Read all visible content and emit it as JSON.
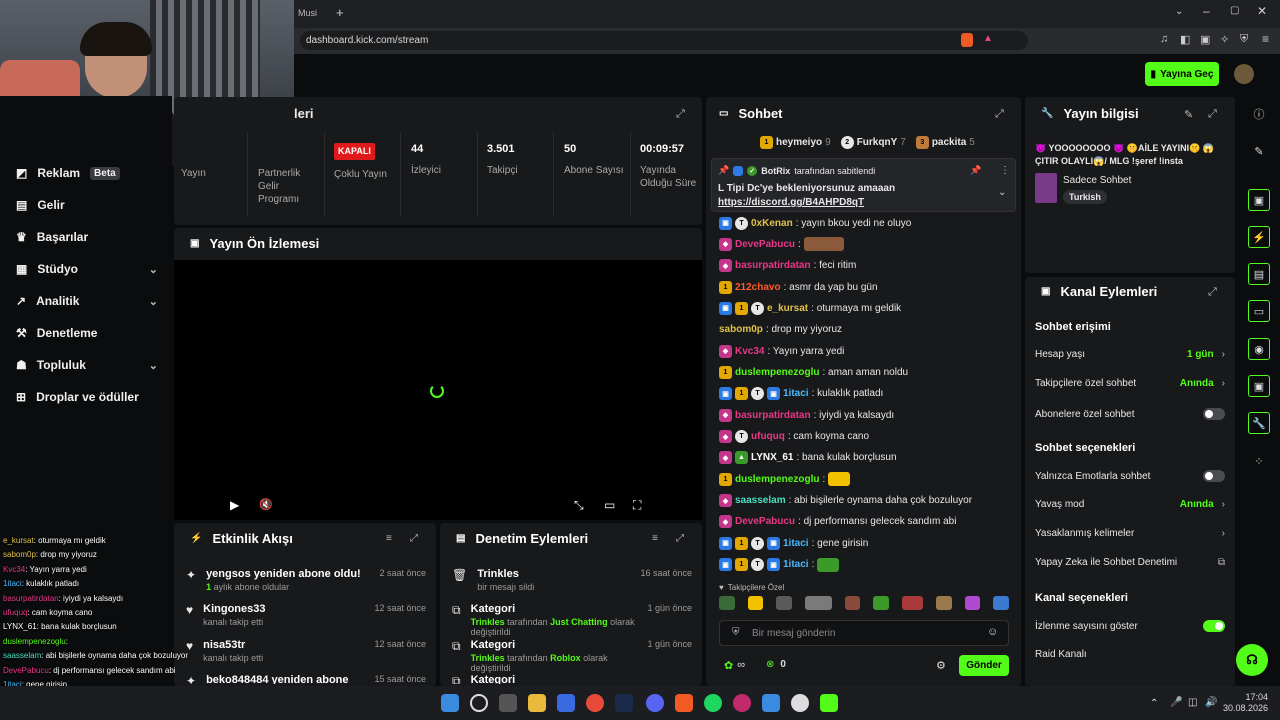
{
  "browser": {
    "tab_label": "Musi",
    "new_tab": "+",
    "url": "dashboard.kick.com/stream"
  },
  "header": {
    "go_live": "Yayına Geç"
  },
  "sidebar": {
    "items": [
      {
        "label": "Reklam",
        "badge": "Beta",
        "icon": "megaphone-icon"
      },
      {
        "label": "Gelir",
        "icon": "wallet-icon"
      },
      {
        "label": "Başarılar",
        "icon": "trophy-icon"
      },
      {
        "label": "Stüdyo",
        "icon": "grid-icon",
        "chevron": true
      },
      {
        "label": "Analitik",
        "icon": "chart-icon",
        "chevron": true
      },
      {
        "label": "Denetleme",
        "icon": "hammer-icon"
      },
      {
        "label": "Topluluk",
        "icon": "people-icon",
        "chevron": true
      },
      {
        "label": "Droplar ve ödüller",
        "icon": "gift-icon"
      }
    ]
  },
  "stream_panel": {
    "title_fragment": "leri",
    "stats": [
      {
        "value": "",
        "label": "Yayın"
      },
      {
        "value": "",
        "label": "Partnerlik Gelir Programı"
      },
      {
        "value": "KAPALI",
        "label": "Çoklu Yayın"
      },
      {
        "value": "44",
        "label": "İzleyici"
      },
      {
        "value": "3.501",
        "label": "Takipçi"
      },
      {
        "value": "50",
        "label": "Abone Sayısı"
      },
      {
        "value": "00:09:57",
        "label": "Yayında Olduğu Süre"
      }
    ]
  },
  "preview": {
    "title": "Yayın Ön İzlemesi"
  },
  "activity": {
    "title": "Etkinlik Akışı",
    "items": [
      {
        "name": "yengsos yeniden abone oldu!",
        "detail_count": "1",
        "detail": " aylık abone oldular",
        "time": "2 saat önce",
        "icon": "star-icon"
      },
      {
        "name": "Kingones33",
        "detail": "kanalı takip etti",
        "time": "12 saat önce",
        "icon": "heart-icon"
      },
      {
        "name": "nisa53tr",
        "detail": "kanalı takip etti",
        "time": "12 saat önce",
        "icon": "heart-icon"
      },
      {
        "name": "beko848484 yeniden abone oldu!",
        "detail": "",
        "time": "15 saat önce",
        "icon": "star-icon"
      }
    ]
  },
  "moderation": {
    "title": "Denetim Eylemleri",
    "items": [
      {
        "name": "Trinkles",
        "detail": "bir mesajı sildi",
        "time": "16 saat önce",
        "icon": "trash-icon"
      },
      {
        "name": "Kategori",
        "actor": "Trinkles",
        "mid": " tarafından ",
        "target": "Just Chatting",
        "tail": " olarak değiştirildi",
        "time": "1 gün önce",
        "icon": "swap-icon"
      },
      {
        "name": "Kategori",
        "actor": "Trinkles",
        "mid": " tarafından ",
        "target": "Roblox",
        "tail": " olarak değiştirildi",
        "time": "1 gün önce",
        "icon": "swap-icon"
      },
      {
        "name": "Kategori",
        "time": "",
        "icon": "swap-icon"
      }
    ]
  },
  "chat": {
    "title": "Sohbet",
    "top_gifters": [
      {
        "name": "heymeiyo",
        "count": "9",
        "rank": "1"
      },
      {
        "name": "FurkqnY",
        "count": "7",
        "rank": "2"
      },
      {
        "name": "packita",
        "count": "5",
        "rank": "3"
      }
    ],
    "pinned": {
      "by": "BotRix",
      "by_suffix": " tarafından sabitlendi",
      "text": "L Tipi Dc'ye bekleniyorsunuz amaaan",
      "link": "https://discord.gg/B4AHPD8qT"
    },
    "messages": [
      {
        "user": "0xKenan",
        "color": "#e0c24a",
        "text": ": yayın bkou yedi ne oluyo",
        "badges": [
          "sub",
          "white"
        ]
      },
      {
        "user": "DevePabucu",
        "color": "#e8388a",
        "text": ":",
        "badges": [
          "pink"
        ],
        "emote": "#8a5a3a"
      },
      {
        "user": "basurpatirdatan",
        "color": "#e8388a",
        "text": ": feci ritim",
        "badges": [
          "pink"
        ]
      },
      {
        "user": "212chavo",
        "color": "#ff5a2a",
        "text": ": asmr da yap bu gün",
        "badges": [
          "gold"
        ]
      },
      {
        "user": "e_kursat",
        "color": "#e0c24a",
        "text": ": oturmaya mı geldik",
        "badges": [
          "sub",
          "gold",
          "white"
        ]
      },
      {
        "user": "sabom0p",
        "color": "#e0c24a",
        "text": ": drop my yiyoruz",
        "badges": []
      },
      {
        "user": "Kvc34",
        "color": "#e8388a",
        "text": ": Yayın yarra yedi",
        "badges": [
          "pink"
        ]
      },
      {
        "user": "duslempenezoglu",
        "color": "#53fc18",
        "text": ": aman aman noldu",
        "badges": [
          "gold"
        ]
      },
      {
        "user": "1itaci",
        "color": "#4ab8ff",
        "text": ": kulaklık patladı",
        "badges": [
          "sub",
          "gold",
          "white",
          "sub"
        ]
      },
      {
        "user": "basurpatirdatan",
        "color": "#e8388a",
        "text": ": iyiydi ya kalsaydı",
        "badges": [
          "pink"
        ]
      },
      {
        "user": "ufuquq",
        "color": "#e8388a",
        "text": ": cam koyma cano",
        "badges": [
          "pink",
          "white"
        ]
      },
      {
        "user": "LYNX_61",
        "color": "#ffffff",
        "text": ": bana kulak borçlusun",
        "badges": [
          "pink",
          "green"
        ]
      },
      {
        "user": "duslempenezoglu",
        "color": "#53fc18",
        "text": ":",
        "badges": [
          "gold"
        ],
        "emote": "#f2c200"
      },
      {
        "user": "saasselam",
        "color": "#4ae0c2",
        "text": ": abi bişilerle oynama daha çok bozuluyor",
        "badges": [
          "pink"
        ]
      },
      {
        "user": "DevePabucu",
        "color": "#e8388a",
        "text": ": dj performansı gelecek sandım abi",
        "badges": [
          "pink"
        ]
      },
      {
        "user": "1itaci",
        "color": "#4ab8ff",
        "text": ": gene girisin",
        "badges": [
          "sub",
          "gold",
          "white",
          "sub"
        ]
      },
      {
        "user": "1itaci",
        "color": "#4ab8ff",
        "text": ":",
        "badges": [
          "sub",
          "gold",
          "white",
          "sub"
        ],
        "emote": "#3a9a2a"
      }
    ],
    "followers_label": "Takipçilere Özel",
    "input_placeholder": "Bir mesaj gönderin",
    "infinity": "∞",
    "count": "0",
    "send": "Gönder"
  },
  "stream_info": {
    "title": "Yayın bilgisi",
    "stream_title": "👿 YOOOOOOOO 👿 🤫AİLE YAYINI🤫 😱ÇITIR OLAYLI😱/ MLG !şeref !insta",
    "category": "Sadece Sohbet",
    "tag": "Turkish"
  },
  "channel_actions": {
    "title": "Kanal Eylemleri",
    "chat_access": "Sohbet erişimi",
    "account_age": {
      "label": "Hesap yaşı",
      "value": "1 gün"
    },
    "followers_only": {
      "label": "Takipçilere özel sohbet",
      "value": "Anında"
    },
    "subs_only": {
      "label": "Abonelere özel sohbet",
      "on": false
    },
    "chat_options": "Sohbet seçenekleri",
    "emote_only": {
      "label": "Yalnızca Emotlarla sohbet",
      "on": false
    },
    "slow_mode": {
      "label": "Yavaş mod",
      "value": "Anında"
    },
    "banned_words": "Yasaklanmış kelimeler",
    "ai_moderation": "Yapay Zeka ile Sohbet Denetimi",
    "channel_options": "Kanal seçenekleri",
    "show_viewers": {
      "label": "İzlenme sayısını göster",
      "on": true
    },
    "raid": "Raid Kanalı"
  },
  "overlay_chat": [
    {
      "user": "e_kursat",
      "text": ": oturmaya mı geldik",
      "color": "#e0c24a"
    },
    {
      "user": "sabom0p",
      "text": ": drop my yiyoruz",
      "color": "#e0c24a"
    },
    {
      "user": "Kvc34",
      "text": ": Yayın yarra yedi",
      "color": "#e8388a"
    },
    {
      "user": "1itaci",
      "text": ": kulaklık patladı",
      "color": "#4ab8ff"
    },
    {
      "user": "basurpatirdatan",
      "text": ": iyiydi ya kalsaydı",
      "color": "#e8388a"
    },
    {
      "user": "ufuquq",
      "text": ": cam koyma cano",
      "color": "#e8388a"
    },
    {
      "user": "LYNX_61",
      "text": ": bana kulak borçlusun",
      "color": "#ffffff"
    },
    {
      "user": "duslempenezoglu",
      "text": ":",
      "color": "#53fc18"
    },
    {
      "user": "saasselam",
      "text": ": abi bişilerle oynama daha çok bozuluyor",
      "color": "#4ae0c2"
    },
    {
      "user": "DevePabucu",
      "text": ": dj performansı gelecek sandım abi",
      "color": "#e8388a"
    },
    {
      "user": "1itaci",
      "text": ": gene girisin",
      "color": "#4ab8ff"
    }
  ],
  "taskbar": {
    "time": "17:04",
    "date": "30.08.2026"
  },
  "colors": {
    "accent": "#53fc18",
    "panel": "#18191b",
    "bg": "#0b0c0d"
  }
}
